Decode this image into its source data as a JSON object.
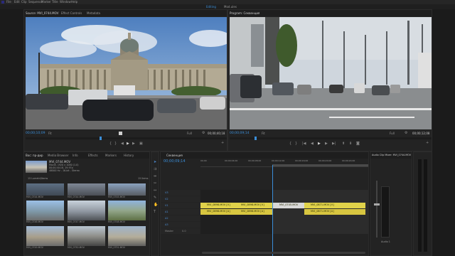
{
  "menu": [
    "File",
    "Edit",
    "Clip",
    "Sequence",
    "Marker",
    "Title",
    "Window",
    "Help"
  ],
  "workspaces": {
    "active": "Editing",
    "other": "Mod.ules"
  },
  "source": {
    "tabs": [
      "Source: MVI_0744.MOV",
      "Effect Controls",
      "Metadata"
    ],
    "timecode": "00;00;10;09",
    "fit": "Fit",
    "full": "Full",
    "duration": "00;00;40;18"
  },
  "program": {
    "tab": "Program: Секвенция",
    "timecode": "00;00;09;14",
    "fit": "Fit",
    "full": "Full",
    "duration": "00;00;12;08"
  },
  "project": {
    "tabs": [
      "Вос: пр-дир",
      "Media Browser",
      "Info",
      "Effects",
      "Markers",
      "History"
    ],
    "preview_name": "MVI_0744.MOV",
    "preview_meta": [
      "Movie, 1920 x 1080 (1.0)",
      "00;00;40;18, 29.97p",
      "48000 Hz - 16-bit - Stereo"
    ],
    "item_count": "15 Items",
    "search_label": "15 Lumetri/Items",
    "items": [
      {
        "name": "MVI_0744.MOV",
        "dur": "40;18"
      },
      {
        "name": "MVI_0744.MOV",
        "dur": "10;12"
      },
      {
        "name": "MVI_0745.MOV",
        "dur": "13;22"
      },
      {
        "name": "MVI_0746.MOV",
        "dur": "22;18"
      },
      {
        "name": "MVI_0747.MOV",
        "dur": "17;26"
      },
      {
        "name": "MVI_0748.MOV",
        "dur": "15;27"
      },
      {
        "name": "MVI_0749.MOV",
        "dur": "3;20"
      },
      {
        "name": "MVI_0750.MOV",
        "dur": "20;00"
      },
      {
        "name": "MVI_0751.MOV",
        "dur": "12;21"
      }
    ]
  },
  "timeline": {
    "tab": "Секвенция",
    "timecode": "00;00;09;14",
    "ruler": [
      "00;00",
      "00;00;04;00",
      "00;00;08;00",
      "00;00;12;00",
      "00;00;16;00",
      "00;00;20;00",
      "00;00;24;00",
      "00;00;28;00"
    ],
    "tracks": [
      "V3",
      "V2",
      "V1",
      "A1",
      "A2",
      "A3"
    ],
    "master": "Master",
    "master_val": "0.0",
    "v_clips": [
      "MVI_0898.MOV [V]",
      "MVI_0898.MOV [V]",
      "MVI_0745.MOV",
      "MVI_0871.MOV [V]"
    ],
    "a_clips": [
      "MVI_0898.MOV [A]",
      "MVI_0898.MOV [A]",
      "MVI_0871.MOV [A]"
    ]
  },
  "audio_mixer": {
    "tab": "Audio Clip Mixer: MVI_0744.MOV",
    "channel": "Audio 1"
  },
  "colors": {
    "accent": "#3b8ed8",
    "clip_yellow": "#e0d24a",
    "clip_audio": "#d8c640",
    "clip_white": "#d8d8d8"
  }
}
